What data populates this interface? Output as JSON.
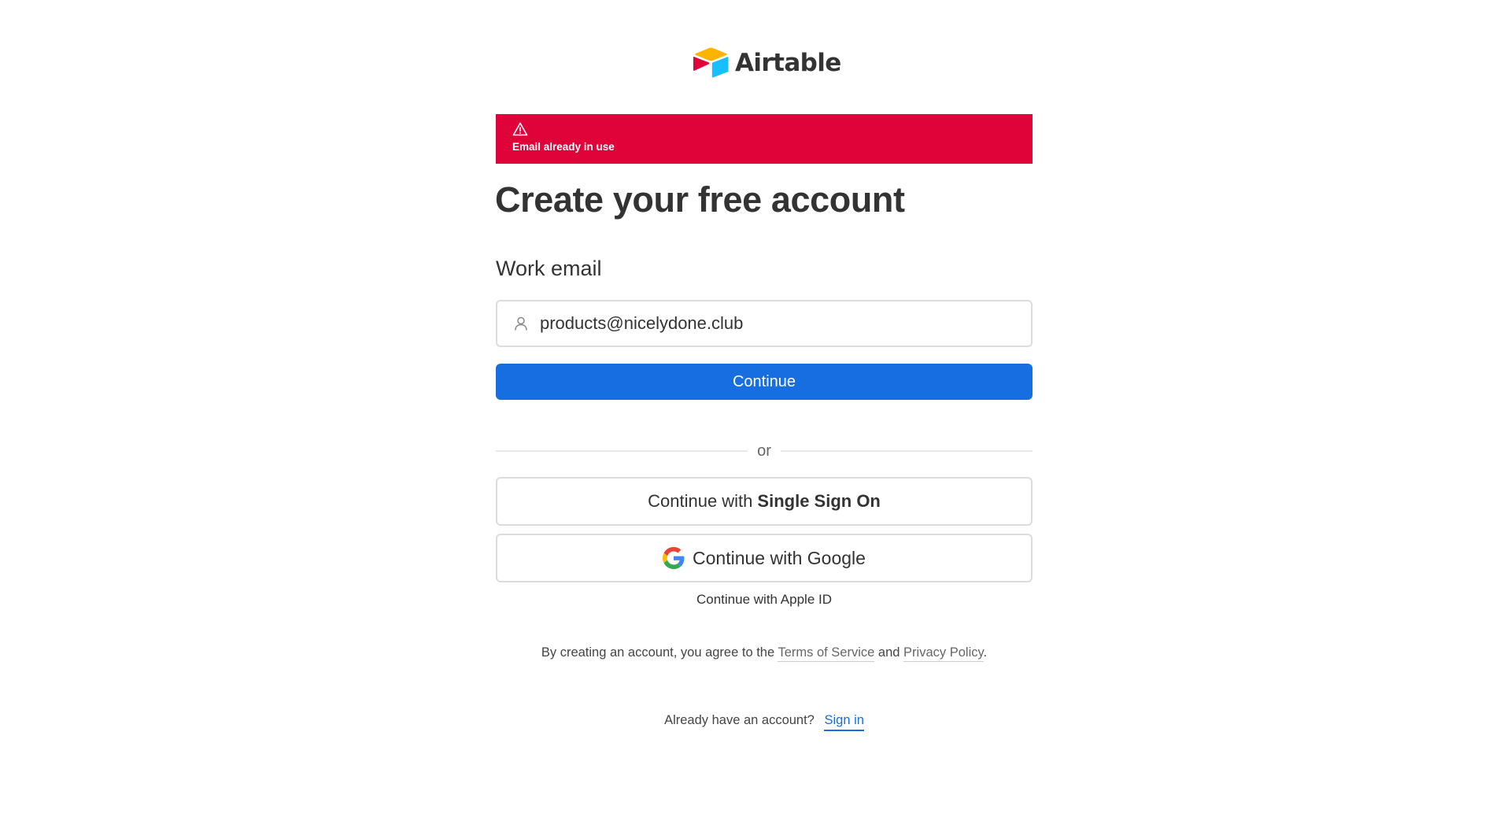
{
  "brand": {
    "name": "Airtable",
    "colors": {
      "yellow": "#fcb400",
      "red": "#e0033a",
      "blue": "#18bfff"
    }
  },
  "error_banner": {
    "icon": "warning-triangle-icon",
    "message": "Email already in use",
    "color": "#e0033a"
  },
  "page_title": "Create your free account",
  "email_field": {
    "label": "Work email",
    "icon": "user-icon",
    "value": "products@nicelydone.club"
  },
  "primary_button": {
    "label": "Continue",
    "color": "#166ee1"
  },
  "divider_text": "or",
  "sso_button": {
    "prefix": "Continue with",
    "emphasis": "Single Sign On"
  },
  "google_button": {
    "icon": "google-icon",
    "label": "Continue with Google"
  },
  "apple_link": "Continue with Apple ID",
  "terms": {
    "prefix": "By creating an account, you agree to the",
    "terms_link": "Terms of Service",
    "conjunction": "and",
    "privacy_link": "Privacy Policy",
    "suffix": "."
  },
  "signin": {
    "prompt": "Already have an account?",
    "link": "Sign in"
  }
}
